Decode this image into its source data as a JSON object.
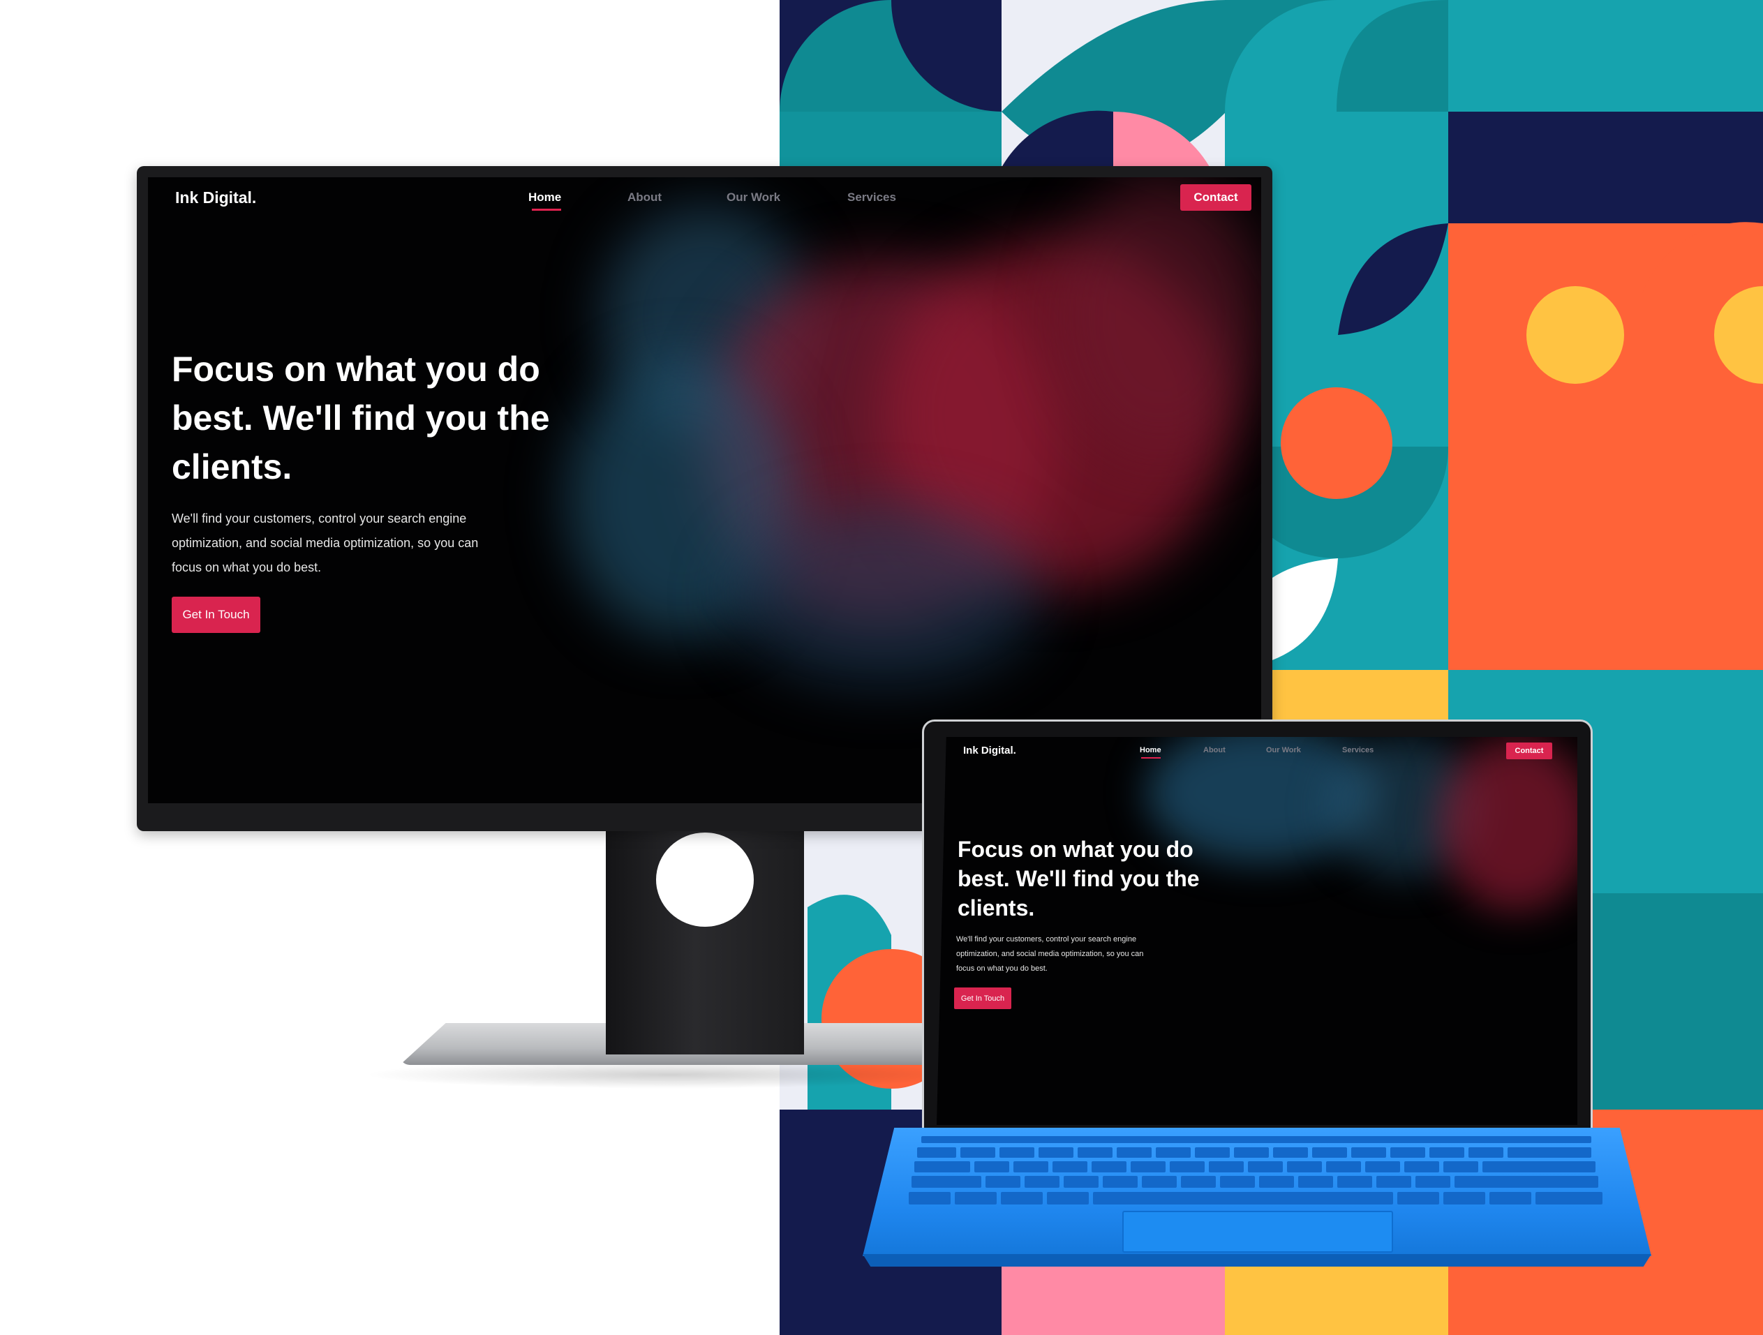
{
  "colors": {
    "accent": "#d9244f",
    "navy": "#141b4d",
    "teal": "#0f8a92",
    "teal_light": "#16a3ae",
    "orange": "#ff6338",
    "pink": "#ff8aa5",
    "yellow": "#ffc342",
    "off_white": "#eceef6",
    "keyboard_blue": "#1f86ee"
  },
  "site": {
    "logo": "Ink Digital.",
    "nav": {
      "home": "Home",
      "about": "About",
      "our_work": "Our Work",
      "services": "Services"
    },
    "active_nav": "Home",
    "contact_label": "Contact",
    "hero": {
      "line1": "Focus on what you do",
      "line2": "best. We'll find you the",
      "line3": "clients.",
      "sub1": "We'll find your customers, control your search engine",
      "sub2": "optimization, and social media optimization, so you can",
      "sub3": "focus on what you do best."
    },
    "cta_label": "Get In Touch"
  },
  "devices": [
    "monitor",
    "tablet-with-keyboard"
  ]
}
